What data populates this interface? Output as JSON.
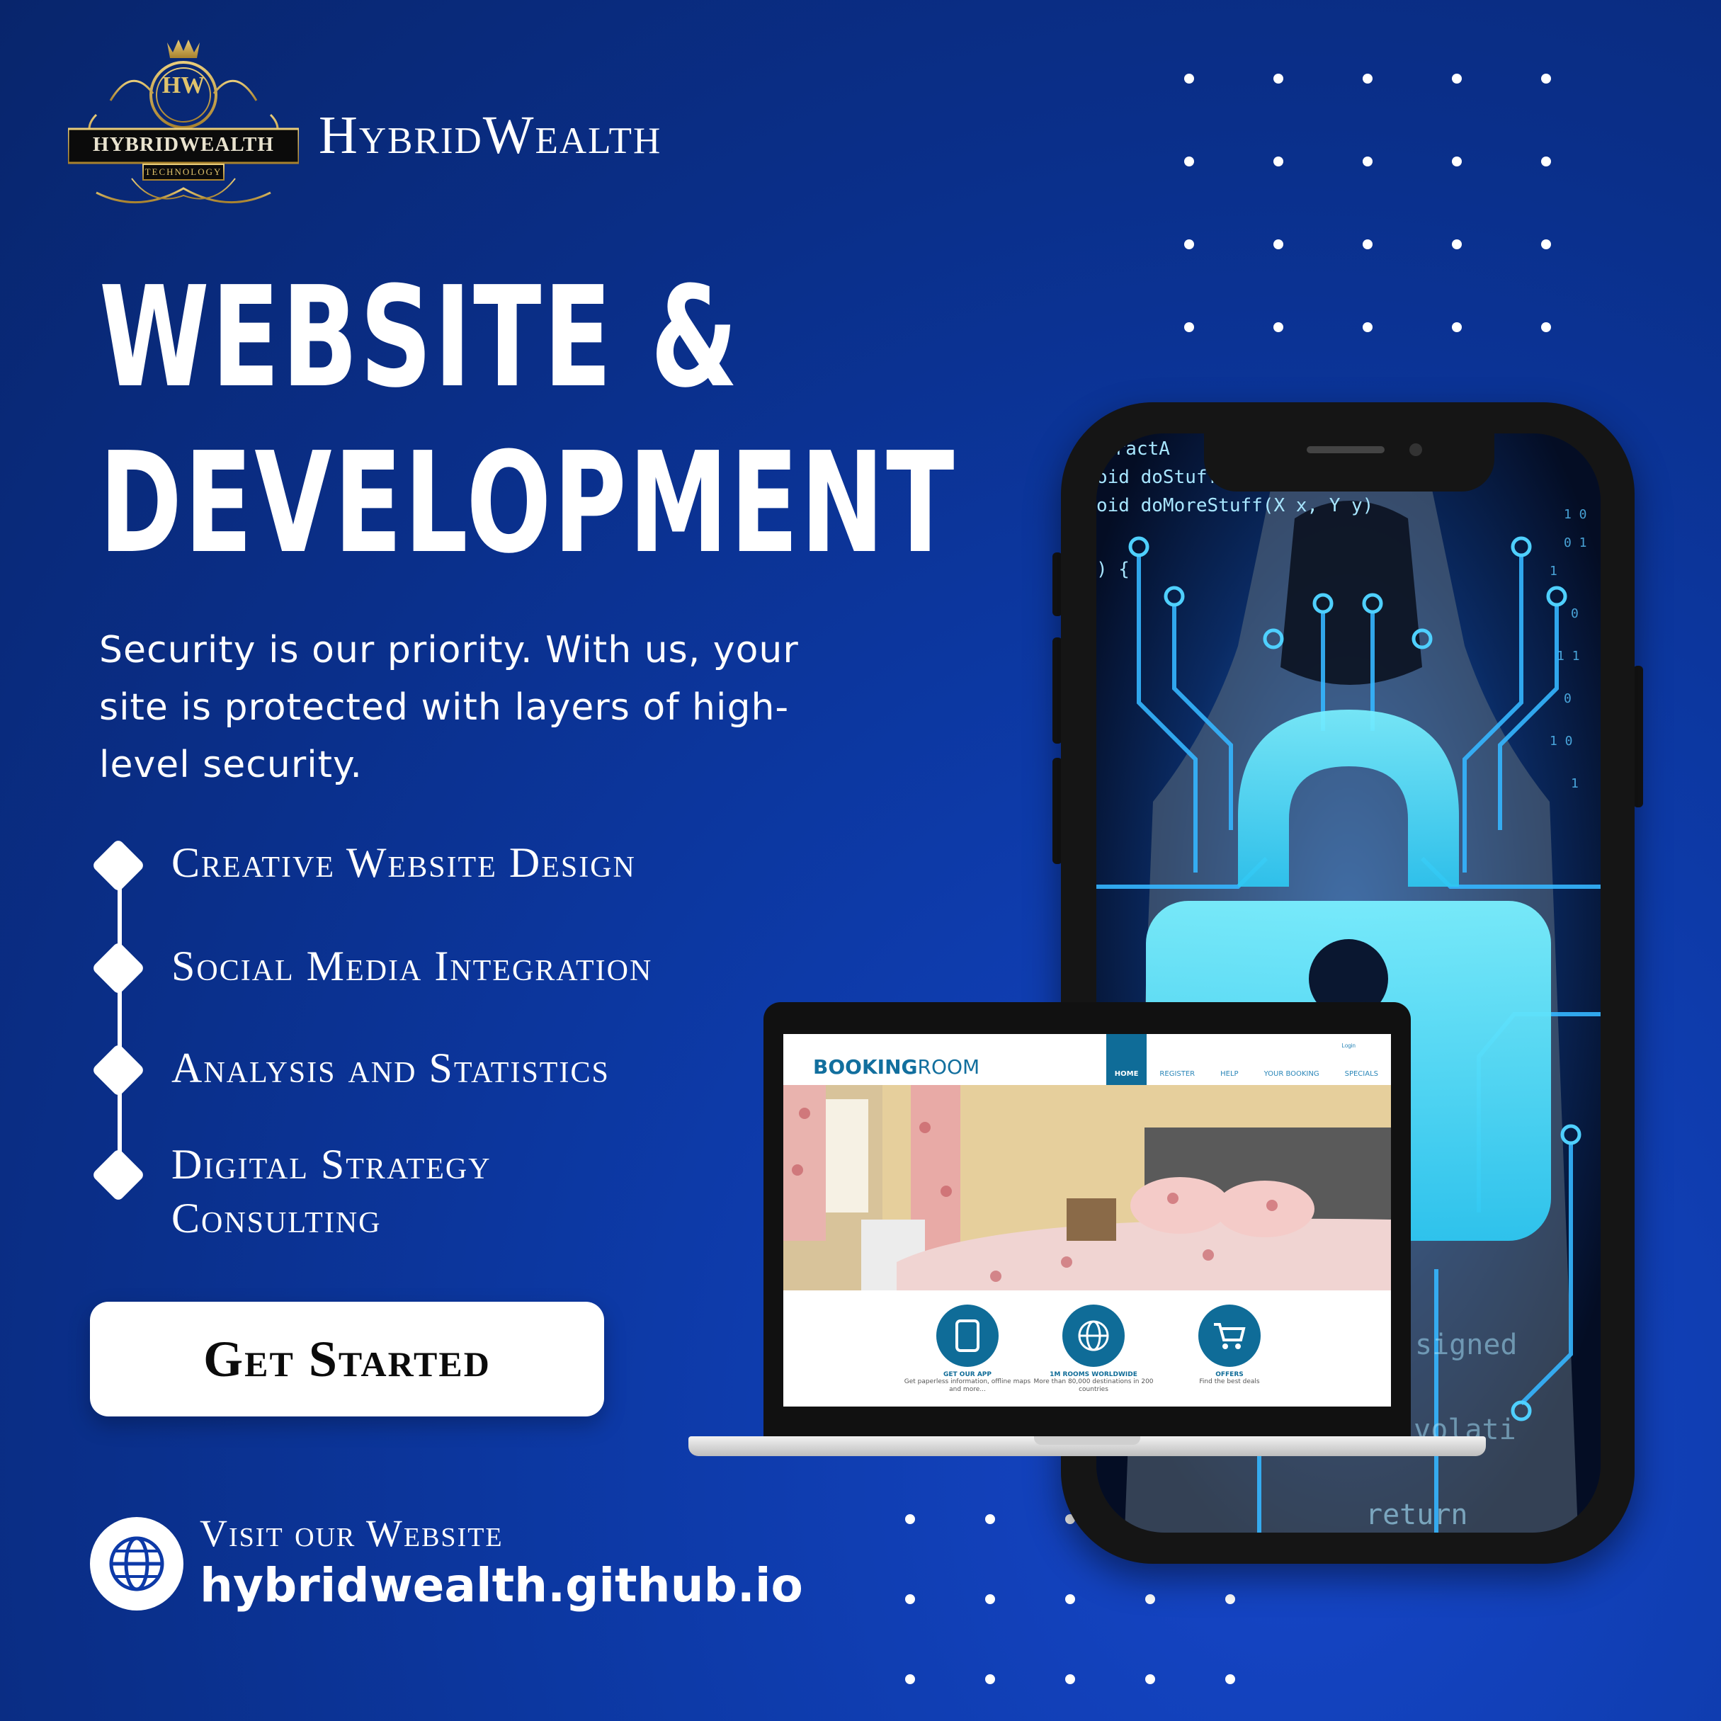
{
  "brand": {
    "name": "HybridWealth",
    "logo_initials": "HW",
    "logo_title": "HYBRIDWEALTH",
    "logo_subtitle": "TECHNOLOGY"
  },
  "headline": {
    "line1": "WEBSITE &",
    "line2": "DEVELOPMENT"
  },
  "tagline": "Security is our priority. With us, your site is protected with layers of high-level security.",
  "features": [
    "Creative Website Design",
    "Social Media Integration",
    "Analysis and Statistics",
    "Digital Strategy Consulting"
  ],
  "cta": {
    "label": "Get Started"
  },
  "footer": {
    "visit_label": "Visit our Website",
    "url": "hybridwealth.github.io"
  },
  "phone_screen": {
    "code_lines": [
      "cractA",
      "oid doStuff(X x)",
      "oid doMoreStuff(X x, Y y)",
      ") {",
      "return",
      "signed",
      "m_volati"
    ]
  },
  "laptop_site": {
    "logo_bold": "BOOKING",
    "logo_light": "ROOM",
    "login": "Login",
    "nav": [
      "HOME",
      "REGISTER",
      "HELP",
      "YOUR BOOKING",
      "SPECIALS"
    ],
    "features": [
      {
        "title": "GET OUR APP",
        "desc": "Get paperless information, offline maps and more..."
      },
      {
        "title": "1M ROOMS WORLDWIDE",
        "desc": "More than 80,000 destinations in 200 countries"
      },
      {
        "title": "OFFERS",
        "desc": "Find the best deals"
      }
    ]
  },
  "colors": {
    "background": "#0a2f8a",
    "accent_gold": "#c9a44c",
    "booking_blue": "#0f6c98",
    "lock_cyan": "#5fe3ff"
  }
}
